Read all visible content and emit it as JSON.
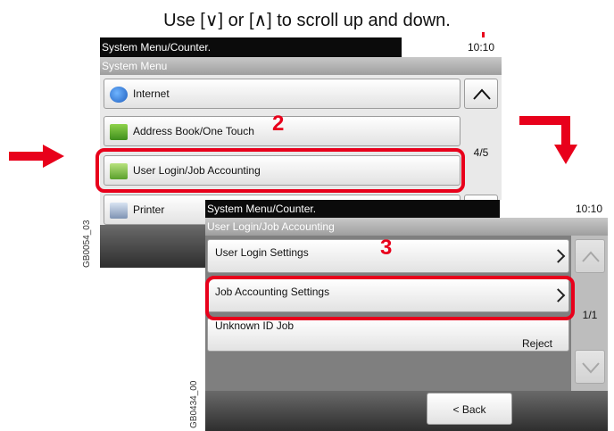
{
  "caption": "Use [∨] or [∧] to scroll up and down.",
  "screen1": {
    "title": "System Menu/Counter.",
    "time": "10:10",
    "subtitle": "System Menu",
    "items": [
      {
        "label": "Internet",
        "icon": "internet-icon"
      },
      {
        "label": "Address Book/One Touch",
        "icon": "address-book-icon"
      },
      {
        "label": "User Login/Job Accounting",
        "icon": "user-login-icon"
      },
      {
        "label": "Printer",
        "icon": "printer-icon"
      }
    ],
    "page": "4/5",
    "step_number": "2",
    "side_id": "GB0054_03"
  },
  "screen2": {
    "title": "System Menu/Counter.",
    "time": "10:10",
    "subtitle": "User Login/Job Accounting",
    "items": [
      {
        "label": "User Login Settings"
      },
      {
        "label": "Job Accounting Settings"
      },
      {
        "label": "Unknown ID Job",
        "value": "Reject"
      }
    ],
    "page": "1/1",
    "back_label": "< Back",
    "step_number": "3",
    "side_id": "GB0434_00"
  },
  "colors": {
    "highlight": "#e8001b",
    "title_bar": "#0b0b0b"
  }
}
